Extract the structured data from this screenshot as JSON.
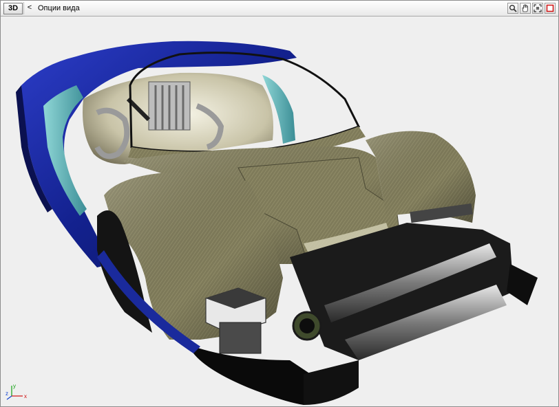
{
  "toolbar": {
    "mode_label": "3D",
    "back_glyph": "<",
    "title": "Опции вида",
    "tools": [
      {
        "icon": "zoom-icon"
      },
      {
        "icon": "pan-hand-icon"
      },
      {
        "icon": "fit-view-icon"
      },
      {
        "icon": "close-view-icon"
      }
    ]
  },
  "axes": {
    "y_label": "y",
    "z_label": "z",
    "x_label": "x"
  },
  "colors": {
    "body_blue": "#1a2a9c",
    "carbon": "#7e7a58",
    "background": "#efefef",
    "x_axis": "#d01010",
    "y_axis": "#10a010",
    "z_axis": "#1040d0"
  }
}
